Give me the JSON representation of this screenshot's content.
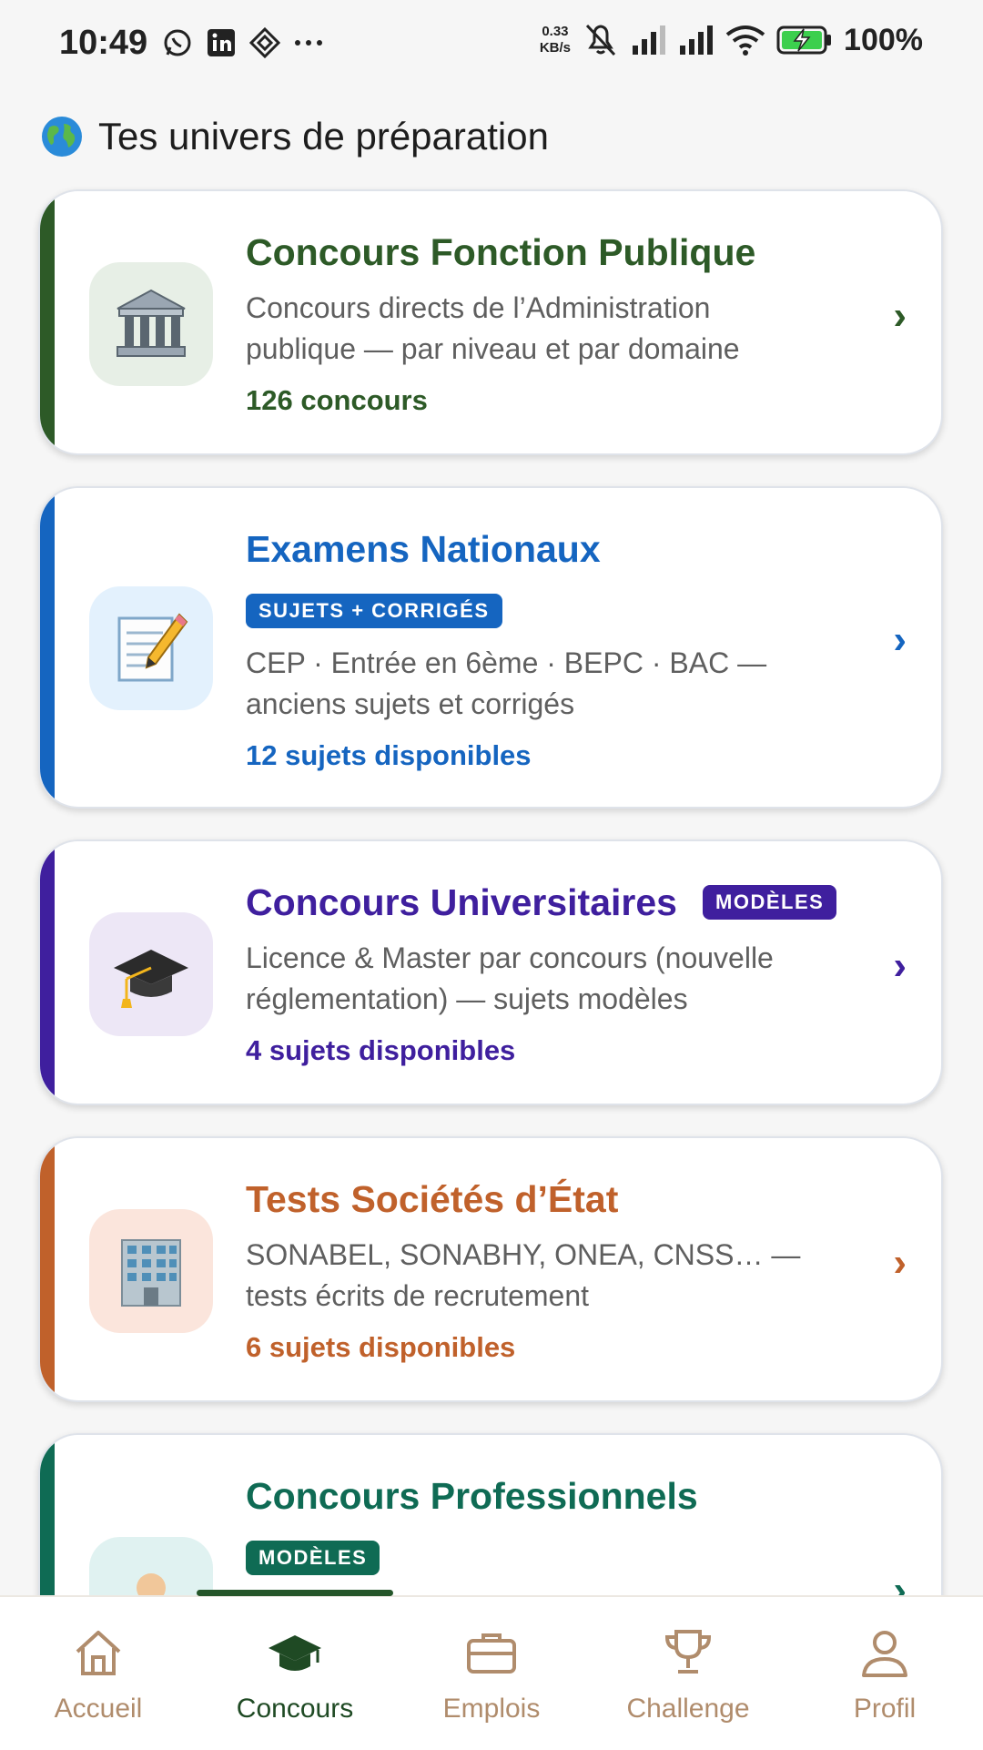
{
  "status_bar": {
    "time": "10:49",
    "speed_value": "0.33",
    "speed_unit": "KB/s",
    "battery": "100%",
    "left_icons": [
      "whatsapp-icon",
      "linkedin-icon",
      "app-icon",
      "more-dots-icon"
    ],
    "right_icons": [
      "mute-icon",
      "signal-icon",
      "signal-icon",
      "wifi-icon",
      "battery-charging-icon"
    ]
  },
  "section": {
    "title": "Tes univers de préparation",
    "icon": "globe-icon"
  },
  "cards": [
    {
      "title": "Concours Fonction Publique",
      "description": "Concours directs de l’Administration publique — par niveau et par domaine",
      "count": "126 concours",
      "icon": "government-building-icon",
      "accent": "#2d5a27",
      "icon_bg": "#e7efe6"
    },
    {
      "title": "Examens Nationaux",
      "badge": "SUJETS + CORRIGÉS",
      "description": "CEP · Entrée en 6ème · BEPC · BAC — anciens sujets et corrigés",
      "count": "12 sujets disponibles",
      "icon": "memo-pencil-icon",
      "accent": "#1565c0",
      "icon_bg": "#e3f1fd"
    },
    {
      "title": "Concours Universitaires",
      "badge": "MODÈLES",
      "description": "Licence & Master par concours (nouvelle réglementation) — sujets modèles",
      "count": "4 sujets disponibles",
      "icon": "graduation-cap-icon",
      "accent": "#3f1f9e",
      "icon_bg": "#ede7f6"
    },
    {
      "title": "Tests Sociétés d’État",
      "description": "SONABEL, SONABHY, ONEA, CNSS… — tests écrits de recrutement",
      "count": "6 sujets disponibles",
      "icon": "office-building-icon",
      "accent": "#c0612b",
      "icon_bg": "#fbe5dc"
    },
    {
      "title": "Concours Professionnels",
      "badge": "MODÈLES",
      "icon": "worker-icon",
      "accent": "#0f6b54",
      "icon_bg": "#e0f2f1"
    }
  ],
  "bottom_nav": {
    "active_index": 1,
    "items": [
      {
        "label": "Accueil",
        "icon": "home-icon"
      },
      {
        "label": "Concours",
        "icon": "graduation-cap-icon"
      },
      {
        "label": "Emplois",
        "icon": "briefcase-icon"
      },
      {
        "label": "Challenge",
        "icon": "trophy-icon"
      },
      {
        "label": "Profil",
        "icon": "user-icon"
      }
    ]
  }
}
